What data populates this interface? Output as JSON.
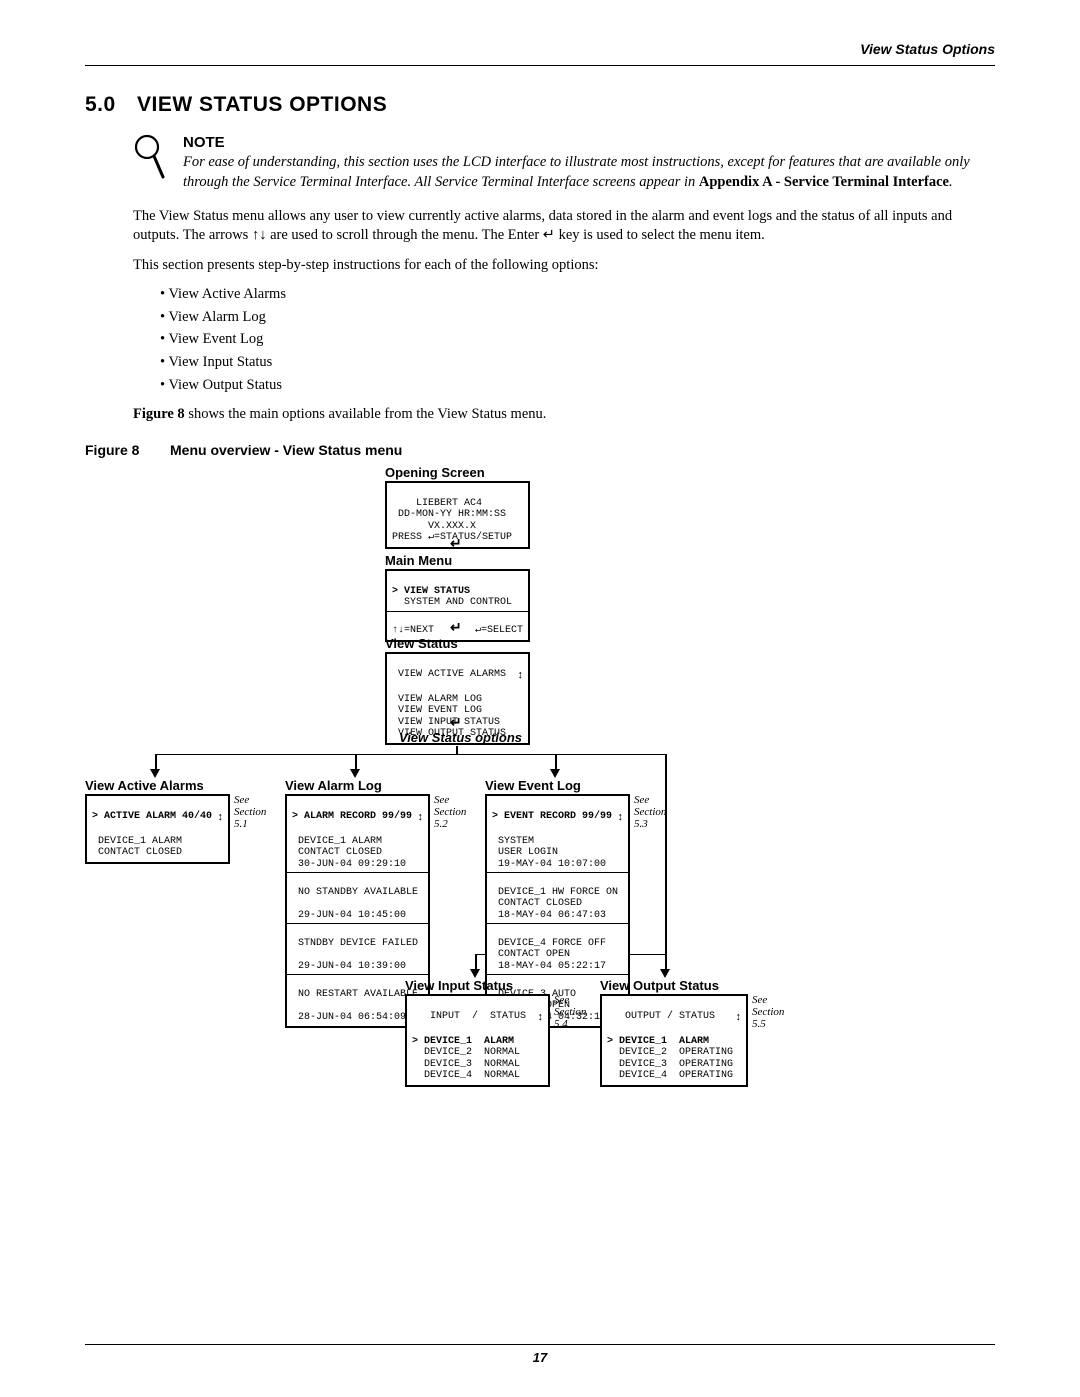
{
  "header": {
    "running": "View Status Options"
  },
  "section": {
    "number": "5.0",
    "title_small": "V",
    "title_rest": "IEW ",
    "title_small2": "S",
    "title_rest2": "TATUS ",
    "title_small3": "O",
    "title_rest3": "PTIONS",
    "full_title": "VIEW STATUS OPTIONS"
  },
  "note": {
    "heading": "NOTE",
    "body_1": "For ease of understanding, this section uses the LCD interface to illustrate most instructions, except for features that are available only through the Service Terminal Interface. All Service Terminal Interface screens appear in ",
    "body_bold": "Appendix A - Service Terminal Interface",
    "body_2": "."
  },
  "para1": "The View Status menu allows any user to view currently active alarms, data stored in the alarm and event logs and the status of all inputs and outputs. The arrows ↑↓ are used to scroll through the menu. The Enter ↵ key is used to select the menu item.",
  "para2": "This section presents step-by-step instructions for each of the following options:",
  "bullets": [
    "View Active Alarms",
    "View Alarm Log",
    "View Event Log",
    "View Input Status",
    "View Output Status"
  ],
  "para3_pre": "Figure 8",
  "para3_rest": " shows the main options available from the View Status menu.",
  "figure": {
    "label": "Figure 8",
    "caption": "Menu overview - View Status menu"
  },
  "diagram": {
    "opening_title": "Opening Screen",
    "opening_lines": [
      "    LIEBERT AC4",
      " DD-MON-YY HR:MM:SS",
      "      VX.XXX.X",
      "PRESS ↵=STATUS/SETUP"
    ],
    "main_title": "Main Menu",
    "main_line1": "> VIEW STATUS",
    "main_line2": "  SYSTEM AND CONTROL",
    "main_nav_left": "↑↓=NEXT",
    "main_nav_right": "↵=SELECT",
    "vs_title": "View Status",
    "vs_lines": [
      " VIEW ACTIVE ALARMS",
      " VIEW ALARM LOG",
      " VIEW EVENT LOG",
      " VIEW INPUT STATUS",
      " VIEW OUTPUT STATUS"
    ],
    "vs_options_label": "View Status options",
    "active": {
      "title": "View Active Alarms",
      "header": "> ACTIVE ALARM 40/40",
      "lines": [
        " DEVICE_1 ALARM",
        " CONTACT CLOSED"
      ],
      "see": "See Section 5.1"
    },
    "alarmlog": {
      "title": "View Alarm Log",
      "header": "> ALARM RECORD 99/99",
      "records": [
        [
          " DEVICE_1 ALARM",
          " CONTACT CLOSED",
          " 30-JUN-04 09:29:10"
        ],
        [
          " NO STANDBY AVAILABLE",
          "",
          " 29-JUN-04 10:45:00"
        ],
        [
          " STNDBY DEVICE FAILED",
          "",
          " 29-JUN-04 10:39:00"
        ],
        [
          " NO RESTART AVAILABLE",
          "",
          " 28-JUN-04 06:54:09"
        ]
      ],
      "see": "See Section 5.2"
    },
    "eventlog": {
      "title": "View Event Log",
      "header": "> EVENT RECORD 99/99",
      "records": [
        [
          " SYSTEM",
          " USER LOGIN",
          " 19-MAY-04 10:07:00"
        ],
        [
          " DEVICE_1 HW FORCE ON",
          " CONTACT CLOSED",
          " 18-MAY-04 06:47:03"
        ],
        [
          " DEVICE_4 FORCE OFF",
          " CONTACT OPEN",
          " 18-MAY-04 05:22:17"
        ],
        [
          " DEVICE_3 AUTO",
          " CONTACT OPEN",
          " 18-MAY-04 04:32:11"
        ]
      ],
      "see": "See Section 5.3"
    },
    "input": {
      "title": "View Input Status",
      "header_l": "   INPUT  /  STATUS",
      "rows": [
        [
          "> DEVICE_1",
          "ALARM"
        ],
        [
          "  DEVICE_2",
          "NORMAL"
        ],
        [
          "  DEVICE_3",
          "NORMAL"
        ],
        [
          "  DEVICE_4",
          "NORMAL"
        ]
      ],
      "see": "See Section 5.4"
    },
    "output": {
      "title": "View Output Status",
      "header_l": "   OUTPUT / STATUS",
      "rows": [
        [
          "> DEVICE_1",
          "ALARM"
        ],
        [
          "  DEVICE_2",
          "OPERATING"
        ],
        [
          "  DEVICE_3",
          "OPERATING"
        ],
        [
          "  DEVICE_4",
          "OPERATING"
        ]
      ],
      "see": "See Section 5.5"
    }
  },
  "page_number": "17"
}
